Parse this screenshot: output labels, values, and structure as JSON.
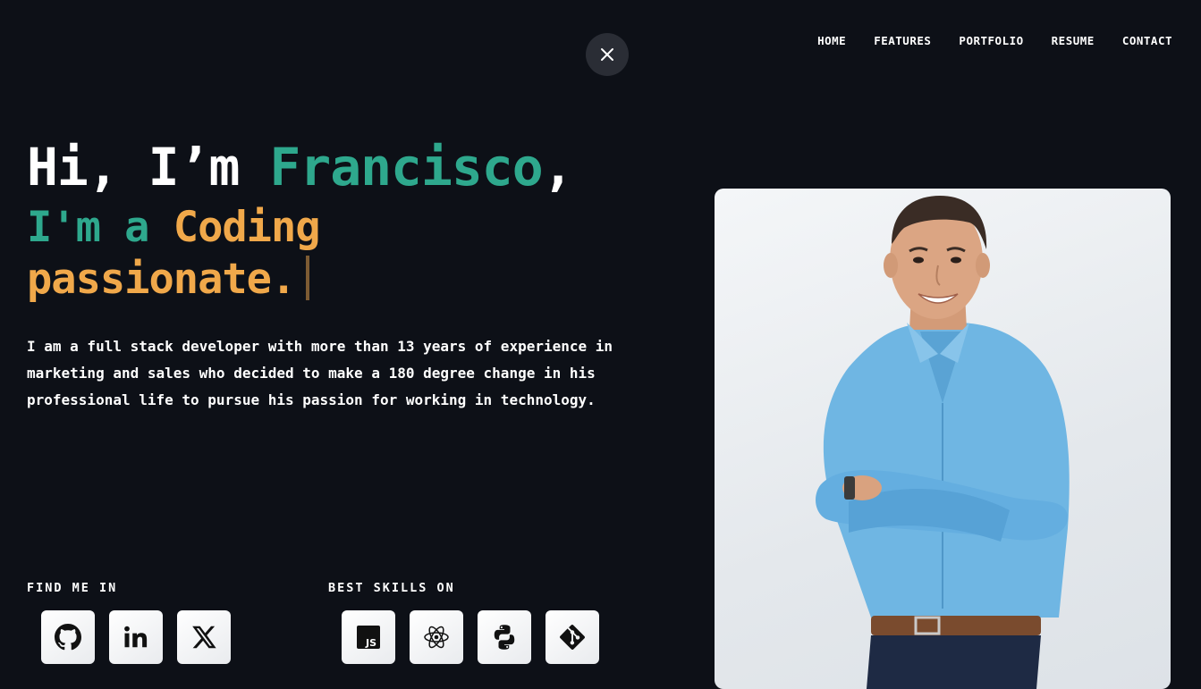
{
  "nav": {
    "items": [
      "HOME",
      "FEATURES",
      "PORTFOLIO",
      "RESUME",
      "CONTACT"
    ]
  },
  "hero": {
    "greeting_prefix": "Hi, I’m ",
    "name": "Francisco",
    "greeting_suffix": ",",
    "tagline_part1": "I'm a ",
    "tagline_part2": "Coding passionate."
  },
  "description": "I am a full stack developer with more than 13 years of experience in marketing and sales who decided to make a 180 degree change in his professional life to pursue his passion for working in technology.",
  "social": {
    "label": "FIND ME IN",
    "icons": [
      "github-icon",
      "linkedin-icon",
      "x-icon"
    ]
  },
  "skills": {
    "label": "BEST SKILLS ON",
    "icons": [
      "javascript-icon",
      "react-icon",
      "python-icon",
      "git-icon"
    ]
  },
  "colors": {
    "background": "#0d1017",
    "accent_teal": "#2ea88d",
    "accent_orange": "#f0a84a"
  }
}
